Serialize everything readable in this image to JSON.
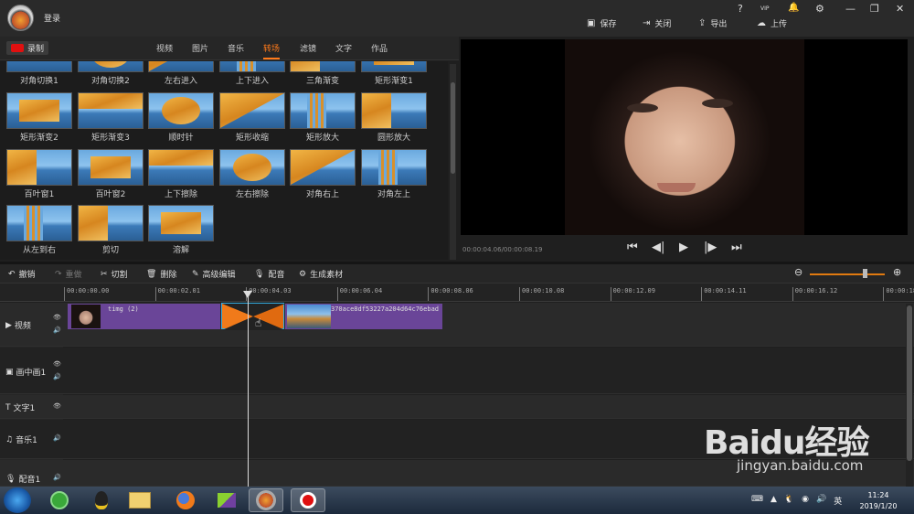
{
  "header": {
    "login": "登录",
    "window_controls": [
      "?",
      "VIP",
      "🔔",
      "⚙",
      "—",
      "❐",
      "✕"
    ],
    "actions": [
      {
        "icon": "save-icon",
        "label": "保存"
      },
      {
        "icon": "close-doc-icon",
        "label": "关闭"
      },
      {
        "icon": "export-icon",
        "label": "导出"
      },
      {
        "icon": "upload-icon",
        "label": "上传"
      }
    ]
  },
  "media_tabs": {
    "record": "录制",
    "tabs": [
      "视频",
      "图片",
      "音乐",
      "转场",
      "滤镜",
      "文字",
      "作品"
    ],
    "active": "转场"
  },
  "transitions": [
    {
      "label": "对角切换1"
    },
    {
      "label": "对角切换2"
    },
    {
      "label": "左右进入"
    },
    {
      "label": "上下进入"
    },
    {
      "label": "三角渐变"
    },
    {
      "label": "矩形渐变1"
    },
    {
      "label": "矩形渐变2"
    },
    {
      "label": "矩形渐变3"
    },
    {
      "label": "顺时针"
    },
    {
      "label": "矩形收缩"
    },
    {
      "label": "矩形放大"
    },
    {
      "label": "圆形放大"
    },
    {
      "label": "百叶窗1"
    },
    {
      "label": "百叶窗2"
    },
    {
      "label": "上下擦除"
    },
    {
      "label": "左右擦除"
    },
    {
      "label": "对角右上"
    },
    {
      "label": "对角左上"
    },
    {
      "label": "从左到右"
    },
    {
      "label": "剪切"
    },
    {
      "label": "溶解"
    }
  ],
  "player": {
    "time": "00:00:04.06/00:00:08.19"
  },
  "edit_toolbar": {
    "undo": "撤销",
    "redo": "重做",
    "cut": "切割",
    "delete": "删除",
    "advanced": "高级编辑",
    "dub": "配音",
    "generate": "生成素材"
  },
  "ruler": [
    "00:00:00.00",
    "00:00:02.01",
    "00:00:04.03",
    "00:00:06.04",
    "00:00:08.06",
    "00:00:10.08",
    "00:00:12.09",
    "00:00:14.11",
    "00:00:16.12",
    "00:00:18."
  ],
  "tracks": [
    {
      "label": "视频"
    },
    {
      "label": "画中画1"
    },
    {
      "label": "文字1"
    },
    {
      "label": "音乐1"
    },
    {
      "label": "配音1"
    }
  ],
  "clips": {
    "clip1": "timg (2)",
    "clip2": "370ace8df53227a204d64c76ebad"
  },
  "taskbar": {
    "clock_time": "11:24",
    "clock_date": "2019/1/20"
  },
  "watermark": {
    "brand": "Baidu经验",
    "url": "jingyan.baidu.com"
  }
}
